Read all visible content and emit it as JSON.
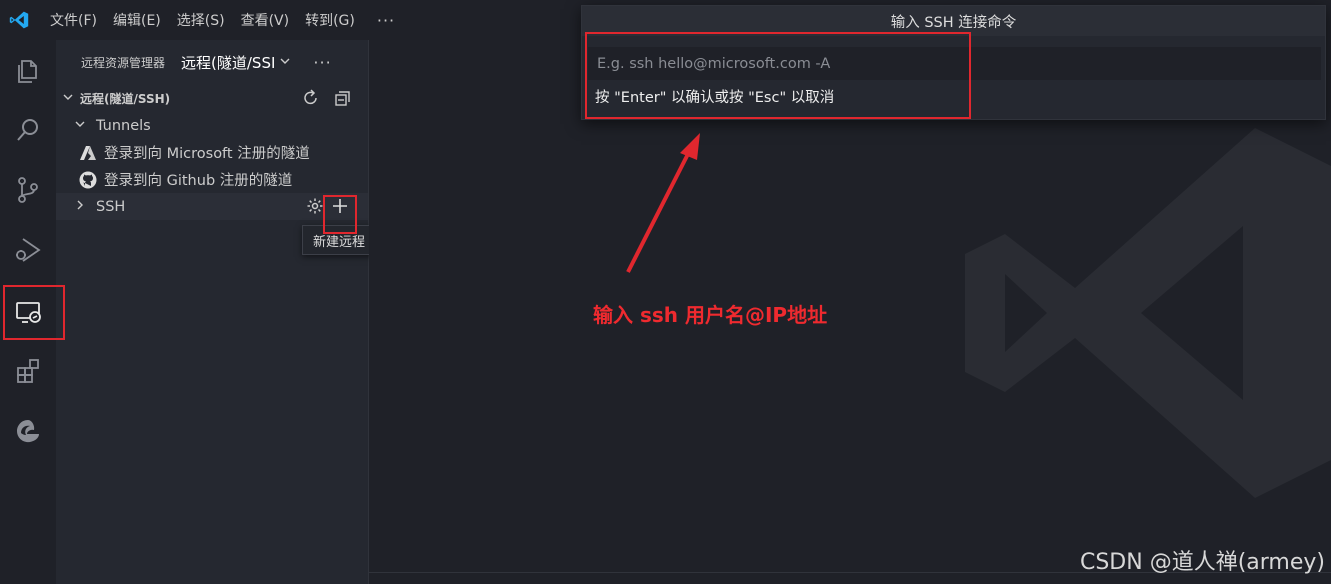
{
  "menu": {
    "items": [
      "文件(F)",
      "编辑(E)",
      "选择(S)",
      "查看(V)",
      "转到(G)"
    ],
    "more": "···"
  },
  "activity_bar": {
    "icons": [
      "explorer-icon",
      "search-icon",
      "source-control-icon",
      "run-debug-icon",
      "remote-explorer-icon",
      "extensions-icon",
      "edge-icon"
    ],
    "active": "remote-explorer-icon"
  },
  "sidebar": {
    "header_title": "远程资源管理器",
    "view_select": "远程(隧道/SSI",
    "more": "···",
    "section_title": "远程(隧道/SSH)",
    "tunnels_label": "Tunnels",
    "tunnel_items": [
      {
        "label": "登录到向 Microsoft 注册的隧道",
        "icon": "azure-icon"
      },
      {
        "label": "登录到向 Github 注册的隧道",
        "icon": "github-icon"
      }
    ],
    "ssh_label": "SSH",
    "tooltip": "新建远程"
  },
  "quick_input": {
    "title": "输入 SSH 连接命令",
    "placeholder": "E.g. ssh hello@microsoft.com -A",
    "hint": "按 \"Enter\" 以确认或按 \"Esc\" 以取消"
  },
  "annotation": {
    "text": "输入 ssh 用户名@IP地址",
    "color": "#e0272e"
  },
  "credit": "CSDN @道人禅(armey)",
  "colors": {
    "background": "#1f2128",
    "sidebar": "#252830",
    "accent": "#0078d4"
  }
}
